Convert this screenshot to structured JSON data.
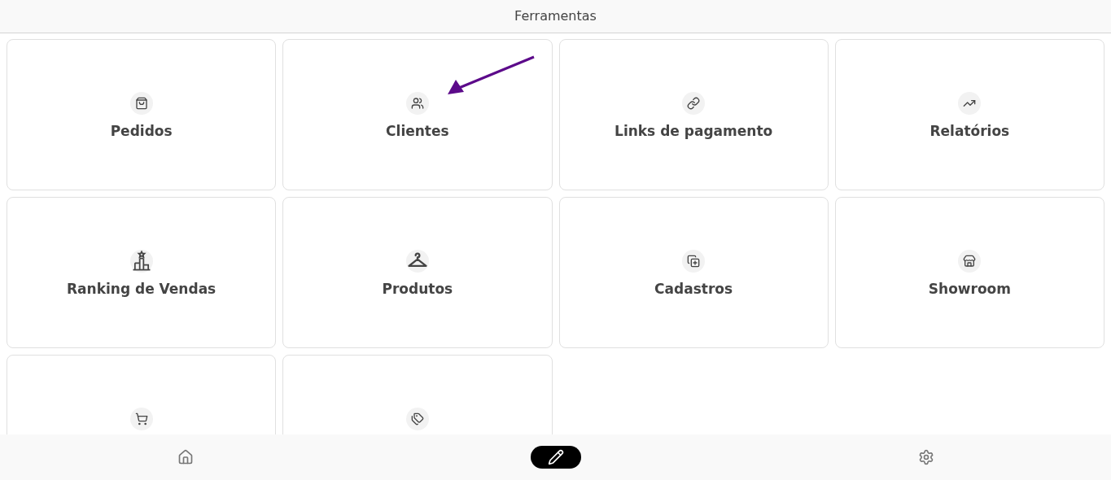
{
  "header": {
    "title": "Ferramentas"
  },
  "tools": [
    {
      "kind": "bag",
      "label": "Pedidos"
    },
    {
      "kind": "people",
      "label": "Clientes"
    },
    {
      "kind": "link",
      "label": "Links de pagamento"
    },
    {
      "kind": "chart",
      "label": "Relatórios"
    },
    {
      "kind": "podium",
      "label": "Ranking de Vendas"
    },
    {
      "kind": "hanger",
      "label": "Produtos"
    },
    {
      "kind": "add",
      "label": "Cadastros"
    },
    {
      "kind": "store",
      "label": "Showroom"
    },
    {
      "kind": "cart"
    },
    {
      "kind": "tags"
    }
  ],
  "annotation": {
    "kind": "arrow"
  },
  "bottom_nav": [
    {
      "kind": "home",
      "selected": false
    },
    {
      "kind": "edit",
      "selected": true
    },
    {
      "kind": "settings",
      "selected": false
    }
  ]
}
